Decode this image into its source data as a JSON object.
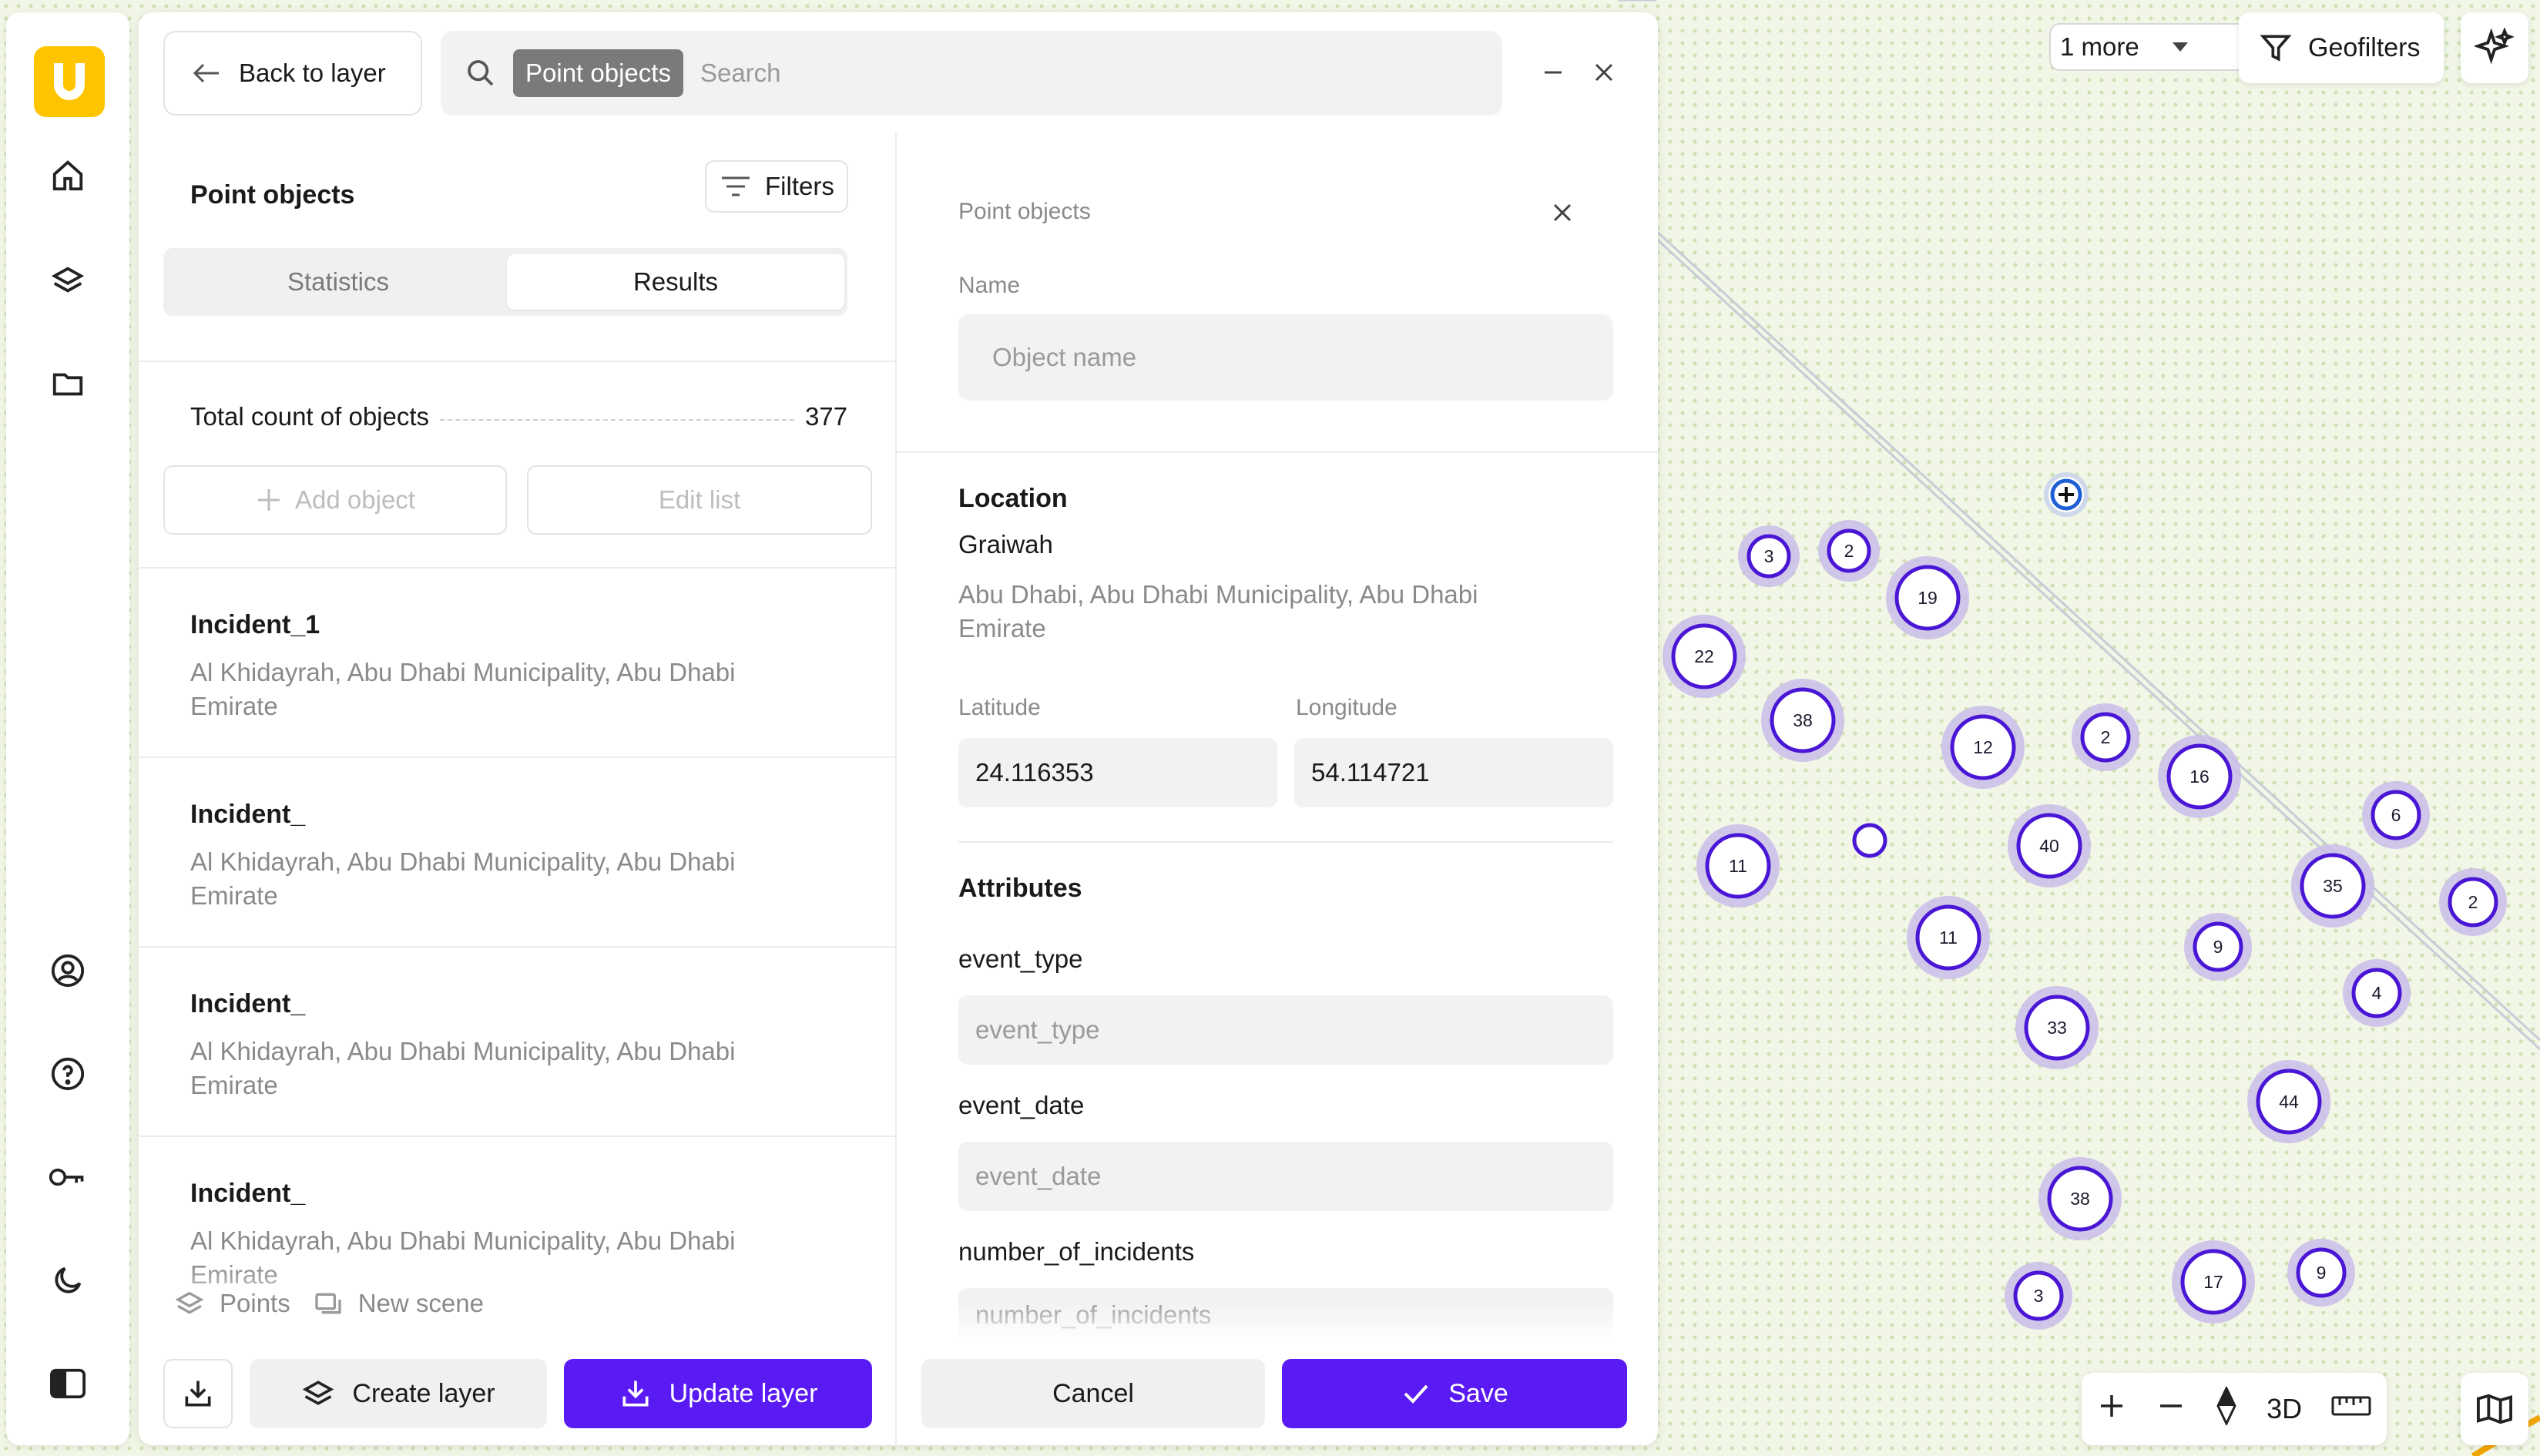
{
  "topbar": {
    "back_label": "Back to layer",
    "search_chip": "Point objects",
    "search_placeholder": "Search"
  },
  "list": {
    "title": "Point objects",
    "filters_label": "Filters",
    "tabs": [
      {
        "label": "Statistics",
        "active": false
      },
      {
        "label": "Results",
        "active": true
      }
    ],
    "total_label": "Total count of objects",
    "total_value": "377",
    "add_object_label": "Add object",
    "edit_list_label": "Edit list",
    "items": [
      {
        "name": "Incident_1",
        "address": "Al Khidayrah, Abu Dhabi Municipality, Abu Dhabi Emirate"
      },
      {
        "name": "Incident_",
        "address": "Al Khidayrah, Abu Dhabi Municipality, Abu Dhabi Emirate"
      },
      {
        "name": "Incident_",
        "address": "Al Khidayrah, Abu Dhabi Municipality, Abu Dhabi Emirate"
      },
      {
        "name": "Incident_",
        "address": "Al Khidayrah, Abu Dhabi Municipality, Abu Dhabi Emirate"
      }
    ],
    "scene": {
      "layer": "Points",
      "scene": "New scene"
    },
    "create_layer_label": "Create layer",
    "update_layer_label": "Update layer"
  },
  "form": {
    "header": "Point objects",
    "name_label": "Name",
    "name_placeholder": "Object name",
    "location_title": "Location",
    "location_name": "Graiwah",
    "location_address": "Abu Dhabi, Abu Dhabi Municipality, Abu Dhabi Emirate",
    "latitude_label": "Latitude",
    "latitude_value": "24.116353",
    "longitude_label": "Longitude",
    "longitude_value": "54.114721",
    "attributes_title": "Attributes",
    "attributes": [
      {
        "label": "event_type",
        "placeholder": "event_type"
      },
      {
        "label": "event_date",
        "placeholder": "event_date"
      },
      {
        "label": "number_of_incidents",
        "placeholder": "number_of_incidents"
      }
    ],
    "cancel_label": "Cancel",
    "save_label": "Save"
  },
  "map": {
    "more_label": "1 more",
    "geofilters_label": "Geofilters",
    "mode_3d_label": "3D",
    "clusters": [
      "3",
      "2",
      "19",
      "22",
      "38",
      "12",
      "2",
      "16",
      "6",
      "11",
      "40",
      "35",
      "2",
      "11",
      "9",
      "4",
      "33",
      "44",
      "38",
      "3",
      "17",
      "9"
    ]
  },
  "colors": {
    "accent": "#5a1af3",
    "cluster_stroke": "#4a16d6",
    "cluster_halo": "#c9bde9",
    "logo": "#ffc400",
    "selected_point": "#1f5fd6"
  },
  "icons": {
    "logo": "u-logo-icon",
    "nav": [
      "home-icon",
      "layers-icon",
      "folder-icon",
      "user-circle-icon",
      "help-icon",
      "key-icon",
      "moon-icon",
      "sidebar-toggle-icon"
    ]
  }
}
